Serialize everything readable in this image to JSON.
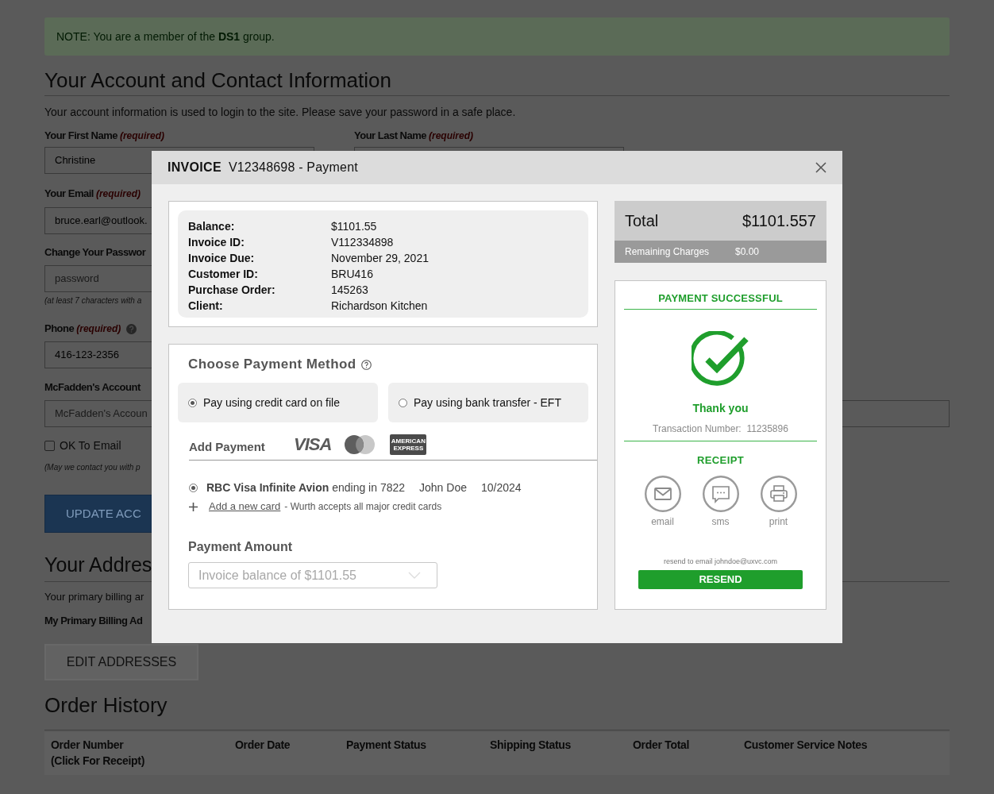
{
  "background_page": {
    "note": "NOTE: You are a member of the **DS1** group.",
    "account_section": {
      "heading": "Your Account and Contact Information",
      "intro": "Your account information is used to login to the site. Please save your password in a safe place.",
      "first_name": {
        "label": "Your First Name",
        "required": "(required)",
        "value": "Christine"
      },
      "last_name": {
        "label": "Your Last Name",
        "required": "(required)"
      },
      "email": {
        "label": "Your Email",
        "required": "(required)",
        "value": "bruce.earl@outlook."
      },
      "password": {
        "label": "Change Your Passwor",
        "placeholder": "password",
        "hint": "(at least 7 characters with a"
      },
      "phone": {
        "label": "Phone",
        "required": "(required)",
        "value": "416-123-2356"
      },
      "account_number": {
        "label": "McFadden's Account",
        "placeholder": "McFadden's Accoun"
      },
      "ok_to_email": {
        "label": "OK To Email",
        "checked": false,
        "hint": "(May we contact you with p"
      },
      "update_button": "UPDATE ACC"
    },
    "address_section": {
      "heading": "Your Addres",
      "intro": "Your primary billing ar",
      "billing_label": "My Primary Billing Ad",
      "edit_button": "EDIT ADDRESSES"
    },
    "order_history": {
      "heading": "Order History",
      "columns": [
        "Order Number\n(Click For Receipt)",
        "Order Date",
        "Payment Status",
        "Shipping Status",
        "Order Total",
        "Customer Service Notes"
      ]
    }
  },
  "modal": {
    "title_bold": "INVOICE",
    "title": "V12348698 - Payment",
    "invoice_details": [
      {
        "label": "Balance:",
        "value": "$1101.55"
      },
      {
        "label": "Invoice ID:",
        "value": "V112334898"
      },
      {
        "label": "Invoice Due:",
        "value": "November 29, 2021"
      },
      {
        "label": "Customer ID:",
        "value": "BRU416"
      },
      {
        "label": "Purchase Order:",
        "value": "145263"
      },
      {
        "label": "Client:",
        "value": "Richardson Kitchen"
      }
    ],
    "payment_method": {
      "heading": "Choose Payment Method",
      "options": [
        {
          "label": "Pay using credit card on file",
          "selected": true
        },
        {
          "label": "Pay using bank transfer - EFT",
          "selected": false
        }
      ],
      "add_payment_label": "Add Payment",
      "card_brands": [
        {
          "kind": "visa",
          "label": "VISA"
        },
        {
          "kind": "mastercard"
        },
        {
          "kind": "amex",
          "label": "AMERICAN EXPRESS"
        }
      ],
      "saved_cards": [
        {
          "name": "**RBC Visa Infinite Avion** ending in 7822",
          "holder": "John Doe",
          "expiry": "10/2024",
          "selected": true
        }
      ],
      "add_card_link": "Add a new card",
      "add_card_note": "- Wurth accepts all major credit cards",
      "amount_heading": "Payment Amount",
      "amount_placeholder": "Invoice balance of $1101.55"
    },
    "summary": {
      "total_label": "Total",
      "total_value": "$1101.557",
      "remaining_label": "Remaining Charges",
      "remaining_value": "$0.00"
    },
    "result": {
      "heading": "PAYMENT SUCCESSFUL",
      "thank_you": "Thank you",
      "transaction": "Transaction Number:  11235896",
      "receipt_heading": "RECEIPT",
      "receipt_options": [
        {
          "kind": "email",
          "label": "email"
        },
        {
          "kind": "sms",
          "label": "sms"
        },
        {
          "kind": "print",
          "label": "print"
        }
      ],
      "resend_note": "resend to email johndoe@uxvc.com",
      "resend_button": "RESEND"
    }
  }
}
